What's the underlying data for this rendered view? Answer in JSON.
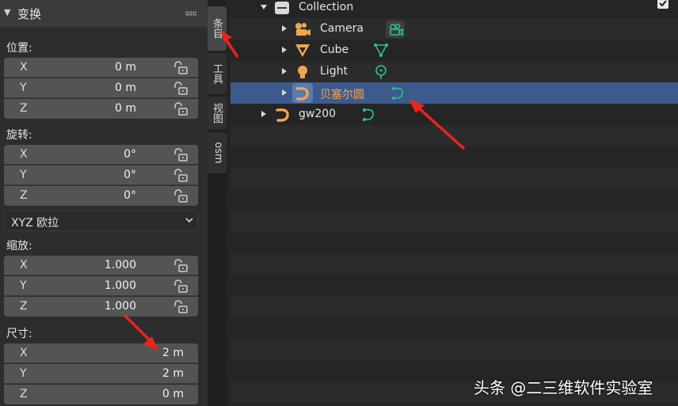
{
  "npanel": {
    "header": {
      "title": "变换"
    },
    "location": {
      "label": "位置:",
      "x": {
        "axis": "X",
        "value": "0 m"
      },
      "y": {
        "axis": "Y",
        "value": "0 m"
      },
      "z": {
        "axis": "Z",
        "value": "0 m"
      }
    },
    "rotation": {
      "label": "旋转:",
      "x": {
        "axis": "X",
        "value": "0°"
      },
      "y": {
        "axis": "Y",
        "value": "0°"
      },
      "z": {
        "axis": "Z",
        "value": "0°"
      },
      "mode": "XYZ 欧拉"
    },
    "scale": {
      "label": "缩放:",
      "x": {
        "axis": "X",
        "value": "1.000"
      },
      "y": {
        "axis": "Y",
        "value": "1.000"
      },
      "z": {
        "axis": "Z",
        "value": "1.000"
      }
    },
    "dimensions": {
      "label": "尺寸:",
      "x": {
        "axis": "X",
        "value": "2 m"
      },
      "y": {
        "axis": "Y",
        "value": "2 m"
      },
      "z": {
        "axis": "Z",
        "value": "0 m"
      }
    }
  },
  "tabs": [
    "条目",
    "工具",
    "视图",
    "osm"
  ],
  "outliner": {
    "collection": "Collection",
    "items": [
      {
        "label": "Camera",
        "icon": "camera-icon",
        "data_icon": "camera-data-icon"
      },
      {
        "label": "Cube",
        "icon": "cube-icon",
        "data_icon": "mesh-data-icon"
      },
      {
        "label": "Light",
        "icon": "light-icon",
        "data_icon": "light-data-icon"
      },
      {
        "label": "贝塞尔圆",
        "icon": "curve-icon",
        "data_icon": "curve-data-icon"
      },
      {
        "label": "gw200",
        "icon": "curve-icon",
        "data_icon": "curve-data-icon"
      }
    ]
  },
  "watermark": "头条 @二三维软件实验室",
  "colors": {
    "accent_orange": "#f0a552",
    "selection_blue": "#3d5a8c",
    "data_green": "#2fbf8f",
    "arrow_red": "#e8261c"
  }
}
